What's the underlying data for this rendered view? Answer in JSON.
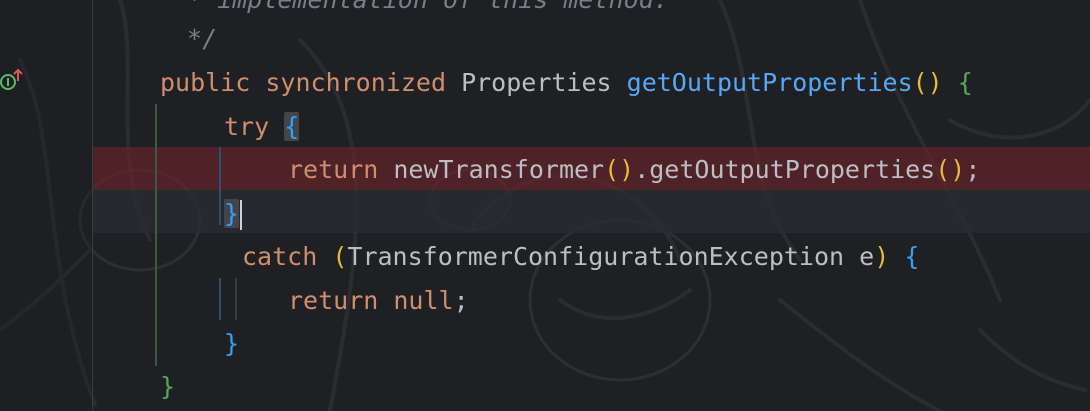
{
  "editor": {
    "gutter": {
      "override_icon": "implements-override-up-arrow-icon"
    },
    "code_lines": [
      {
        "id": "comment-line",
        "tokens": [
          {
            "t": " * implementation of this method.",
            "c": "cm"
          }
        ]
      },
      {
        "id": "comment-end",
        "tokens": [
          {
            "t": " */",
            "c": "cm"
          }
        ]
      },
      {
        "id": "method-signature",
        "tokens": [
          {
            "t": "public",
            "c": "kw"
          },
          {
            "t": " ",
            "c": "id"
          },
          {
            "t": "synchronized",
            "c": "kw"
          },
          {
            "t": " ",
            "c": "id"
          },
          {
            "t": "Properties",
            "c": "id"
          },
          {
            "t": " ",
            "c": "id"
          },
          {
            "t": "getOutputProperties",
            "c": "fn"
          },
          {
            "t": "()",
            "c": "p1"
          },
          {
            "t": " ",
            "c": "id"
          },
          {
            "t": "{",
            "c": "p2"
          }
        ]
      },
      {
        "id": "try-line",
        "tokens": [
          {
            "t": "try",
            "c": "kw"
          },
          {
            "t": " ",
            "c": "id"
          },
          {
            "t": "{",
            "c": "p3",
            "match": true
          }
        ]
      },
      {
        "id": "return-transformer-line",
        "tokens": [
          {
            "t": "return",
            "c": "kw"
          },
          {
            "t": " ",
            "c": "id"
          },
          {
            "t": "newTransformer",
            "c": "id"
          },
          {
            "t": "()",
            "c": "p1"
          },
          {
            "t": ".getOutputProperties",
            "c": "id"
          },
          {
            "t": "()",
            "c": "p1"
          },
          {
            "t": ";",
            "c": "id"
          }
        ]
      },
      {
        "id": "try-close-line",
        "tokens": [
          {
            "t": "}",
            "c": "p3",
            "match": true,
            "caret": true
          }
        ]
      },
      {
        "id": "catch-line",
        "tokens": [
          {
            "t": "catch",
            "c": "kw"
          },
          {
            "t": " ",
            "c": "id"
          },
          {
            "t": "(",
            "c": "p1"
          },
          {
            "t": "TransformerConfigurationException e",
            "c": "id"
          },
          {
            "t": ")",
            "c": "p1"
          },
          {
            "t": " ",
            "c": "id"
          },
          {
            "t": "{",
            "c": "p3"
          }
        ]
      },
      {
        "id": "return-null-line",
        "tokens": [
          {
            "t": "return",
            "c": "kw"
          },
          {
            "t": " ",
            "c": "id"
          },
          {
            "t": "null",
            "c": "kw"
          },
          {
            "t": ";",
            "c": "id"
          }
        ]
      },
      {
        "id": "catch-close-line",
        "tokens": [
          {
            "t": "}",
            "c": "p3"
          }
        ]
      },
      {
        "id": "method-close-line",
        "tokens": [
          {
            "t": "}",
            "c": "p2"
          }
        ]
      }
    ],
    "colors": {
      "keyword": "#cf8e6d",
      "comment": "#7a7e85",
      "method_declaration": "#56a8f5",
      "identifier": "#bcbec4",
      "bracket_level_1": "#e8ba36",
      "bracket_level_2": "#54a857",
      "bracket_level_3": "#359ff4",
      "breakpoint_line_bg": "#5a2a30",
      "caret_line_bg": "#2a2c32"
    }
  }
}
